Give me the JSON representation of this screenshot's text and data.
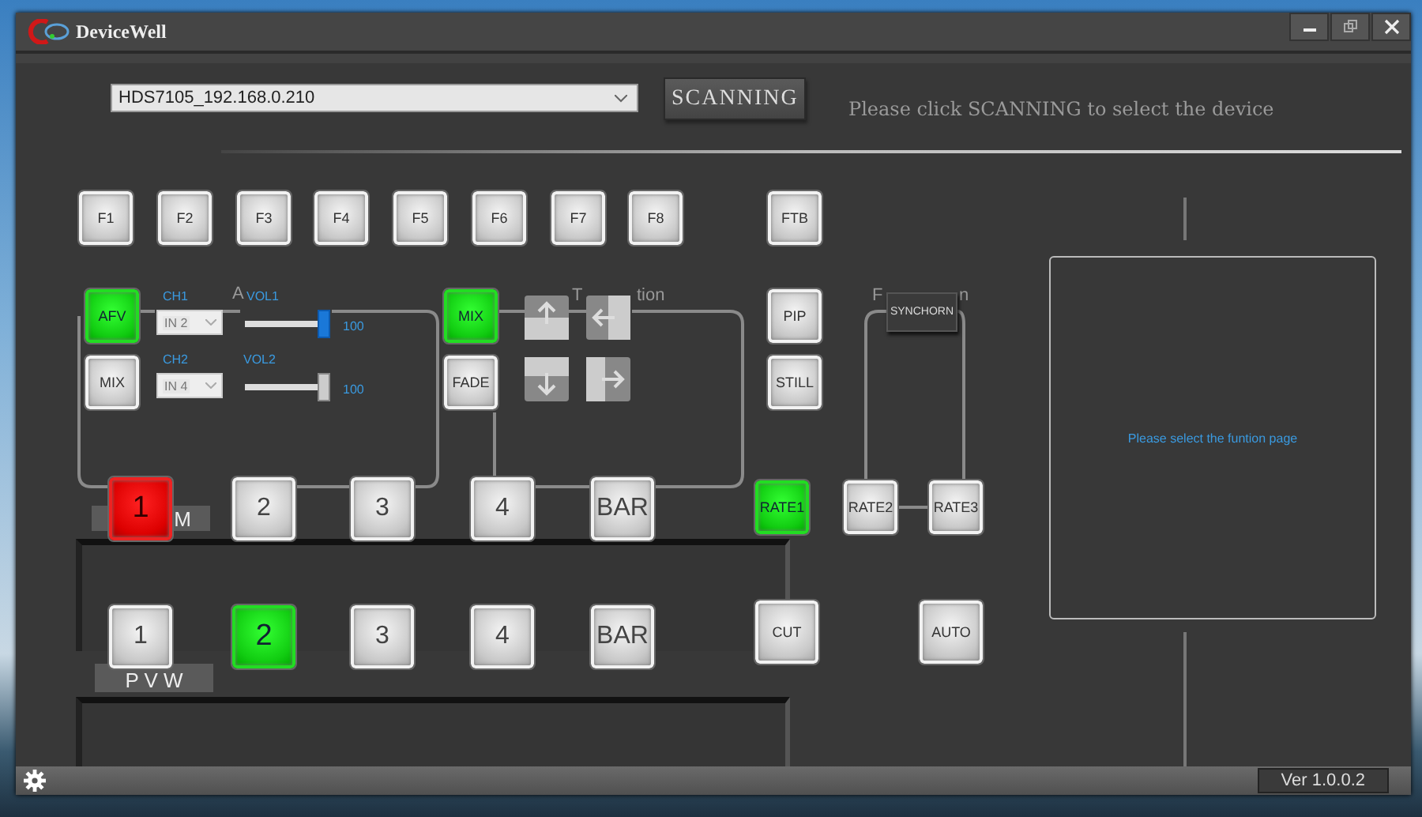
{
  "window": {
    "title": "DeviceWell"
  },
  "device": {
    "value": "HDS7105_192.168.0.210"
  },
  "scan_button": "SCANNING",
  "hint": "Please click SCANNING to select the device",
  "function_keys": [
    {
      "label": "F1",
      "on": false
    },
    {
      "label": "F2",
      "on": false
    },
    {
      "label": "F3",
      "on": false
    },
    {
      "label": "F4",
      "on": false
    },
    {
      "label": "F5",
      "on": false
    },
    {
      "label": "F6",
      "on": false
    },
    {
      "label": "F7",
      "on": false
    },
    {
      "label": "F8",
      "on": false
    }
  ],
  "ftb": {
    "label": "FTB",
    "on": false
  },
  "audio": {
    "group_label": "A",
    "afv": {
      "label": "AFV",
      "on": true
    },
    "mix": {
      "label": "MIX",
      "on": false
    },
    "channels": [
      {
        "label": "CH1",
        "input": "IN 2",
        "disabled": true,
        "vol_label": "VOL1",
        "level": 1,
        "reading": "100",
        "selected": true
      },
      {
        "label": "CH2",
        "input": "IN 4",
        "disabled": true,
        "vol_label": "VOL2",
        "level": 1,
        "reading": "100",
        "selected": false
      }
    ]
  },
  "transition": {
    "label_parts": [
      "T",
      "tion"
    ],
    "mix": {
      "label": "MIX",
      "on": true
    },
    "fade": {
      "label": "FADE",
      "on": false
    }
  },
  "pip": {
    "label": "PIP",
    "on": false
  },
  "still": {
    "label": "STILL",
    "on": false
  },
  "rate": {
    "label_parts": [
      "F",
      "n"
    ],
    "synchorn": "SYNCHORN",
    "buttons": [
      {
        "label": "RATE1",
        "on": true
      },
      {
        "label": "RATE2",
        "on": false
      },
      {
        "label": "RATE3",
        "on": false
      }
    ]
  },
  "pgm": {
    "label": "M",
    "buttons": [
      {
        "label": "1",
        "on": true
      },
      {
        "label": "2",
        "on": false
      },
      {
        "label": "3",
        "on": false
      },
      {
        "label": "4",
        "on": false
      },
      {
        "label": "BAR",
        "on": false
      }
    ]
  },
  "pvw": {
    "label": "P V W",
    "buttons": [
      {
        "label": "1",
        "on": false
      },
      {
        "label": "2",
        "on": true
      },
      {
        "label": "3",
        "on": false
      },
      {
        "label": "4",
        "on": false
      },
      {
        "label": "BAR",
        "on": false
      }
    ]
  },
  "cut": {
    "label": "CUT",
    "on": false
  },
  "auto": {
    "label": "AUTO",
    "on": false
  },
  "function_page": {
    "message": "Please select the funtion page"
  },
  "status_bar": {
    "version": "Ver 1.0.0.2"
  }
}
